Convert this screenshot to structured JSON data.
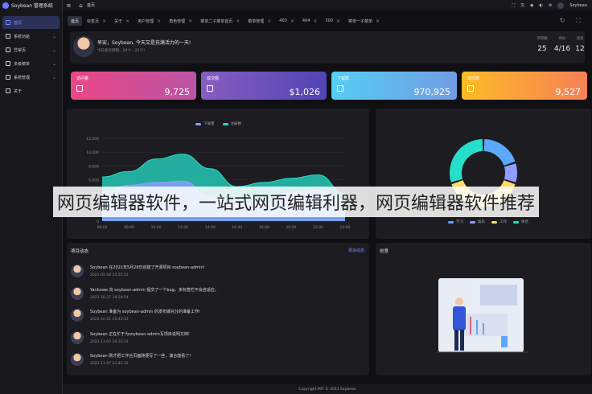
{
  "app": {
    "title": "Soybean 管理系统"
  },
  "sidebar": {
    "items": [
      {
        "label": "首页",
        "icon": "home-icon",
        "active": true,
        "expandable": false
      },
      {
        "label": "系统功能",
        "icon": "function-icon",
        "active": false,
        "expandable": true
      },
      {
        "label": "异常页",
        "icon": "exception-icon",
        "active": false,
        "expandable": true
      },
      {
        "label": "多级菜单",
        "icon": "menu-icon",
        "active": false,
        "expandable": true
      },
      {
        "label": "系统管理",
        "icon": "settings-icon",
        "active": false,
        "expandable": true
      },
      {
        "label": "关于",
        "icon": "about-icon",
        "active": false,
        "expandable": false
      }
    ]
  },
  "topbar": {
    "breadcrumb": "首页",
    "user": "Soybean"
  },
  "tabs": [
    {
      "label": "首页",
      "active": true
    },
    {
      "label": "标签页",
      "active": false
    },
    {
      "label": "关于",
      "active": false
    },
    {
      "label": "用户管理",
      "active": false
    },
    {
      "label": "角色管理",
      "active": false
    },
    {
      "label": "菜单二子菜单首页",
      "active": false
    },
    {
      "label": "菜单管理",
      "active": false
    },
    {
      "label": "403",
      "active": false
    },
    {
      "label": "404",
      "active": false
    },
    {
      "label": "500",
      "active": false
    },
    {
      "label": "菜单一子菜单",
      "active": false
    }
  ],
  "greeting": {
    "title": "早安，Soybean, 今天又是充满活力的一天!",
    "subtitle": "今日多云转晴，20℃ - 25℃!",
    "stats": [
      {
        "label": "项目数",
        "value": "25"
      },
      {
        "label": "待办",
        "value": "4/16"
      },
      {
        "label": "消息",
        "value": "12"
      }
    ]
  },
  "metrics": [
    {
      "label": "访问量",
      "value": "9,725",
      "from": "#ec4786",
      "to": "#b955a4"
    },
    {
      "label": "成交额",
      "value": "$1,026",
      "from": "#865ec0",
      "to": "#5144b4"
    },
    {
      "label": "下载数",
      "value": "970,925",
      "from": "#56cdf3",
      "to": "#719de3"
    },
    {
      "label": "成交数",
      "value": "9,527",
      "from": "#fcbc25",
      "to": "#f68057"
    }
  ],
  "chart_data": {
    "type": "area",
    "x": [
      "06:00",
      "08:00",
      "10:00",
      "12:00",
      "14:00",
      "16:00",
      "18:00",
      "20:00",
      "22:00",
      "24:00"
    ],
    "ylim": [
      0,
      12000
    ],
    "yticks": [
      "12,000",
      "10,000",
      "8,000",
      "6,000",
      "4,000",
      "2,000",
      "0"
    ],
    "series": [
      {
        "name": "下载量",
        "color": "#8e9dff",
        "values": [
          4300,
          5200,
          5600,
          5800,
          3600,
          2600,
          2400,
          4200,
          4500,
          3000
        ]
      },
      {
        "name": "注册数",
        "color": "#26deca",
        "values": [
          6400,
          7200,
          9000,
          9700,
          7600,
          5000,
          5600,
          6200,
          6700,
          4000
        ]
      }
    ]
  },
  "donut": {
    "legend": [
      "学习",
      "娱乐",
      "工作",
      "休息"
    ],
    "values": [
      20,
      10,
      40,
      30
    ],
    "colors": [
      "#5da8ff",
      "#8e9dff",
      "#fedc69",
      "#26deca"
    ]
  },
  "projects": {
    "title": "项目动态",
    "more": "更多动态",
    "items": [
      {
        "title": "Soybean 在2021年5月28日创建了开源项目 soybean-admin!",
        "date": "2021-05-28 22:22:22"
      },
      {
        "title": "Yanbowe 向 soybean-admin 提交了一个bug，多标签栏不会自适应。",
        "date": "2021-10-27 10:24:54"
      },
      {
        "title": "Soybean 准备为 soybean-admin 的发布做充分的准备工作!",
        "date": "2021-10-31 22:43:12"
      },
      {
        "title": "Soybean 正在忙于为soybean-admin写项目说明文档!",
        "date": "2021-11-03 20:33:31"
      },
      {
        "title": "Soybean 刚才把工作台页面随便写了一些，凑合能看了!",
        "date": "2021-11-07 22:45:32"
      }
    ]
  },
  "create": {
    "title": "创意"
  },
  "watermark": "网页编辑器软件，一站式网页编辑利器，网页编辑器软件推荐",
  "footer": "Copyright MIT © 2021 Soybean"
}
